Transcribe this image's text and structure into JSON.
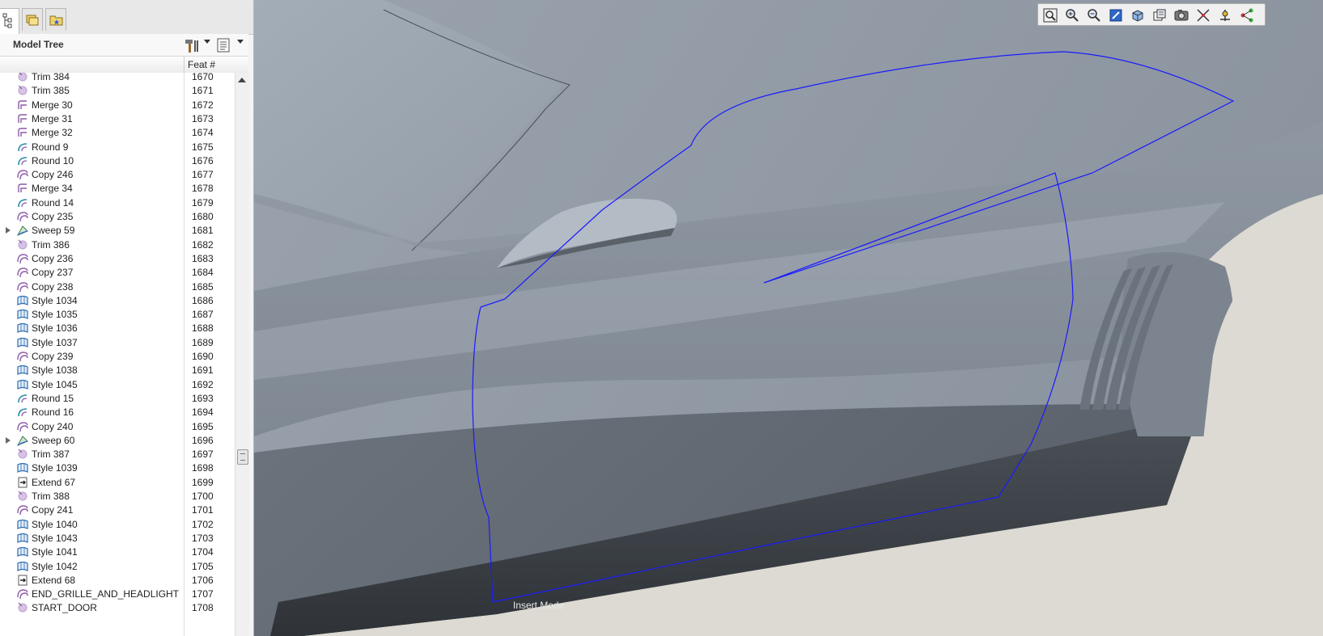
{
  "navigator": {
    "tabs": [
      {
        "name": "model-tree-tab-icon",
        "active": true
      },
      {
        "name": "folder-browser-tab-icon",
        "active": false
      },
      {
        "name": "favorites-tab-icon",
        "active": false
      }
    ]
  },
  "model_tree": {
    "title": "Model Tree",
    "settings_icon": "hammer-settings-icon",
    "show_icon": "show-columns-icon",
    "column_name": "",
    "column_feat": "Feat #",
    "rows": [
      {
        "name": "Trim 384",
        "num": "1670",
        "icon": "trim",
        "expand": false
      },
      {
        "name": "Trim 385",
        "num": "1671",
        "icon": "trim",
        "expand": false
      },
      {
        "name": "Merge 30",
        "num": "1672",
        "icon": "merge",
        "expand": false
      },
      {
        "name": "Merge 31",
        "num": "1673",
        "icon": "merge",
        "expand": false
      },
      {
        "name": "Merge 32",
        "num": "1674",
        "icon": "merge",
        "expand": false
      },
      {
        "name": "Round 9",
        "num": "1675",
        "icon": "round",
        "expand": false
      },
      {
        "name": "Round 10",
        "num": "1676",
        "icon": "round",
        "expand": false
      },
      {
        "name": "Copy 246",
        "num": "1677",
        "icon": "copy",
        "expand": false
      },
      {
        "name": "Merge 34",
        "num": "1678",
        "icon": "merge",
        "expand": false
      },
      {
        "name": "Round 14",
        "num": "1679",
        "icon": "round",
        "expand": false
      },
      {
        "name": "Copy 235",
        "num": "1680",
        "icon": "copy",
        "expand": false
      },
      {
        "name": "Sweep 59",
        "num": "1681",
        "icon": "sweep",
        "expand": true
      },
      {
        "name": "Trim 386",
        "num": "1682",
        "icon": "trim",
        "expand": false
      },
      {
        "name": "Copy 236",
        "num": "1683",
        "icon": "copy",
        "expand": false
      },
      {
        "name": "Copy 237",
        "num": "1684",
        "icon": "copy",
        "expand": false
      },
      {
        "name": "Copy 238",
        "num": "1685",
        "icon": "copy",
        "expand": false
      },
      {
        "name": "Style 1034",
        "num": "1686",
        "icon": "style",
        "expand": false
      },
      {
        "name": "Style 1035",
        "num": "1687",
        "icon": "style",
        "expand": false
      },
      {
        "name": "Style 1036",
        "num": "1688",
        "icon": "style",
        "expand": false
      },
      {
        "name": "Style 1037",
        "num": "1689",
        "icon": "style",
        "expand": false
      },
      {
        "name": "Copy 239",
        "num": "1690",
        "icon": "copy",
        "expand": false
      },
      {
        "name": "Style 1038",
        "num": "1691",
        "icon": "style",
        "expand": false
      },
      {
        "name": "Style 1045",
        "num": "1692",
        "icon": "style",
        "expand": false
      },
      {
        "name": "Round 15",
        "num": "1693",
        "icon": "round",
        "expand": false
      },
      {
        "name": "Round 16",
        "num": "1694",
        "icon": "round",
        "expand": false
      },
      {
        "name": "Copy 240",
        "num": "1695",
        "icon": "copy",
        "expand": false
      },
      {
        "name": "Sweep 60",
        "num": "1696",
        "icon": "sweep",
        "expand": true
      },
      {
        "name": "Trim 387",
        "num": "1697",
        "icon": "trim",
        "expand": false
      },
      {
        "name": "Style 1039",
        "num": "1698",
        "icon": "style",
        "expand": false
      },
      {
        "name": "Extend 67",
        "num": "1699",
        "icon": "extend",
        "expand": false
      },
      {
        "name": "Trim 388",
        "num": "1700",
        "icon": "trim",
        "expand": false
      },
      {
        "name": "Copy 241",
        "num": "1701",
        "icon": "copy",
        "expand": false
      },
      {
        "name": "Style 1040",
        "num": "1702",
        "icon": "style",
        "expand": false
      },
      {
        "name": "Style 1043",
        "num": "1703",
        "icon": "style",
        "expand": false
      },
      {
        "name": "Style 1041",
        "num": "1704",
        "icon": "style",
        "expand": false
      },
      {
        "name": "Style 1042",
        "num": "1705",
        "icon": "style",
        "expand": false
      },
      {
        "name": "Extend 68",
        "num": "1706",
        "icon": "extend",
        "expand": false
      },
      {
        "name": "END_GRILLE_AND_HEADLIGHT",
        "num": "1707",
        "icon": "copy",
        "expand": false
      },
      {
        "name": "START_DOOR",
        "num": "1708",
        "icon": "trim",
        "expand": false
      }
    ]
  },
  "view_toolbar": {
    "buttons": [
      {
        "name": "refit-icon"
      },
      {
        "name": "zoom-in-icon"
      },
      {
        "name": "zoom-out-icon"
      },
      {
        "name": "repaint-icon"
      },
      {
        "name": "display-style-icon"
      },
      {
        "name": "saved-views-icon"
      },
      {
        "name": "view-manager-icon"
      },
      {
        "name": "datum-display-icon"
      },
      {
        "name": "spin-center-icon"
      },
      {
        "name": "annotation-display-icon"
      }
    ]
  },
  "viewport": {
    "status_text": "Insert Mode",
    "colors": {
      "background": "#dcdad2",
      "body": "#8d96a1",
      "sketch_line": "#1a1aff"
    }
  }
}
